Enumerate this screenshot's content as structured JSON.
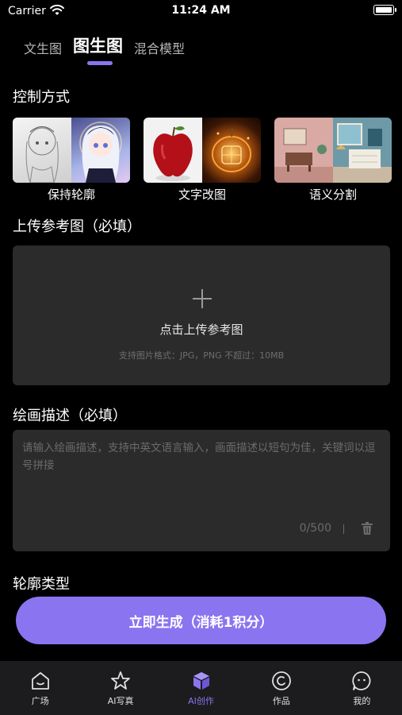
{
  "status_bar": {
    "carrier": "Carrier",
    "time": "11:24 AM"
  },
  "top_tabs": [
    {
      "label": "文生图",
      "active": false
    },
    {
      "label": "图生图",
      "active": true
    },
    {
      "label": "混合模型",
      "active": false
    }
  ],
  "control_section": {
    "title": "控制方式",
    "modes": [
      {
        "label": "保持轮廓",
        "icon": "anime-girl-sketch-thumbnail",
        "active": true
      },
      {
        "label": "文字改图",
        "icon": "apple-thumbnail",
        "active": false
      },
      {
        "label": "语义分割",
        "icon": "room-interior-thumbnail",
        "active": false
      }
    ]
  },
  "upload_section": {
    "title": "上传参考图（必填）",
    "button_label": "点击上传参考图",
    "hint": "支持图片格式：JPG，PNG 不超过：10MB"
  },
  "description_section": {
    "title": "绘画描述（必填）",
    "placeholder": "请输入绘画描述，支持中英文语言输入，画面描述以短句为佳，关键词以逗号拼接",
    "value": "",
    "char_count": "0/500"
  },
  "contour_section": {
    "title": "轮廓类型"
  },
  "generate_button": {
    "label": "立即生成（消耗1积分）"
  },
  "bottom_nav": [
    {
      "label": "广场",
      "icon": "home-icon",
      "active": false
    },
    {
      "label": "AI写真",
      "icon": "star-icon",
      "active": false
    },
    {
      "label": "AI创作",
      "icon": "cube-icon",
      "active": true
    },
    {
      "label": "作品",
      "icon": "creation-icon",
      "active": false
    },
    {
      "label": "我的",
      "icon": "chat-face-icon",
      "active": false
    }
  ],
  "colors": {
    "accent": "#8b74f0",
    "panel": "#2b2b2b",
    "nav_bg": "#1c1c1e"
  }
}
